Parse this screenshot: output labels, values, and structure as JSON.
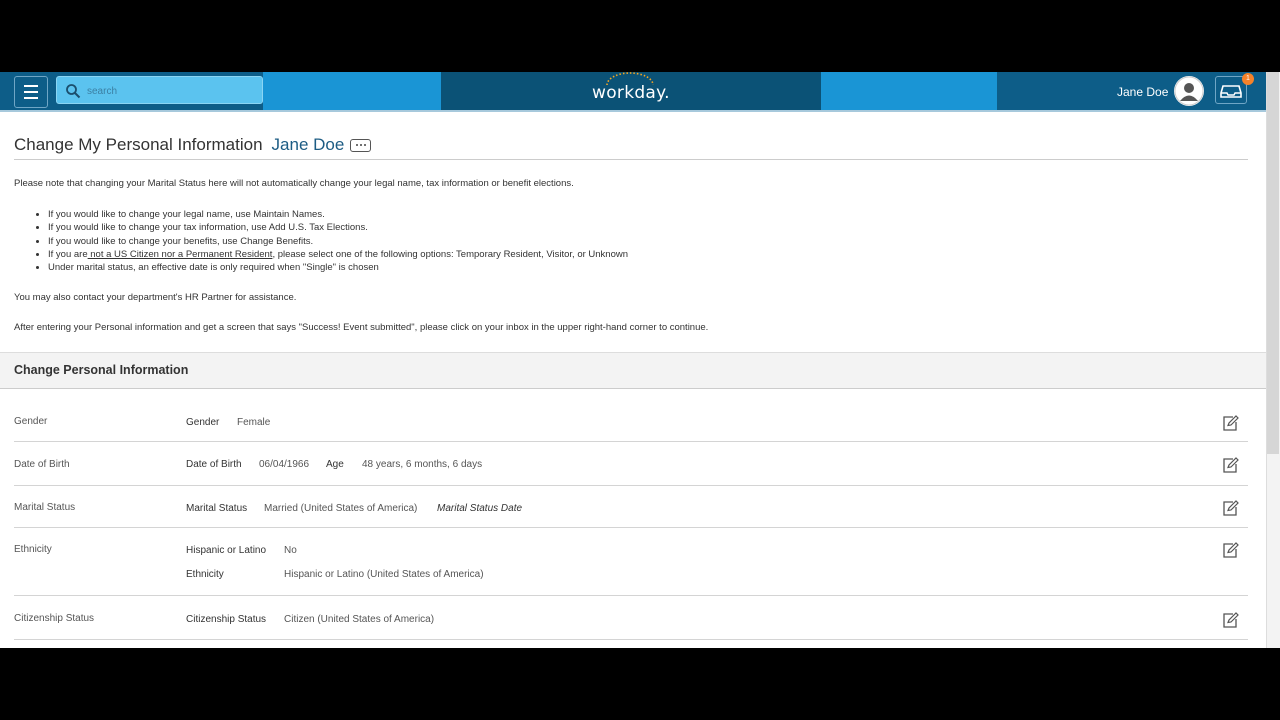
{
  "header": {
    "search_placeholder": "search",
    "logo": "workday.",
    "user_name": "Jane Doe",
    "inbox_count": "1",
    "colors": {
      "bar": "#0d5d88",
      "accent": "#1a95d5",
      "badge": "#f5822a"
    }
  },
  "page": {
    "title": "Change My Personal Information",
    "title_name": "Jane Doe",
    "intro": "Please note that changing your Marital Status here will not automatically change your legal name, tax information or benefit elections.",
    "bullets": {
      "b1": "If you would like to change your legal name, use Maintain Names.",
      "b2": "If you would like to change your tax information, use Add U.S. Tax Elections.",
      "b3": "If you would like to change your benefits, use Change Benefits.",
      "b4_pre": "If you are",
      "b4_link": " not a US Citizen nor a Permanent Resident",
      "b4_post": ", please select one of the following options: Temporary Resident, Visitor, or Unknown",
      "b5": "Under marital status, an effective date is only required when \"Single\" is chosen"
    },
    "contact": "You may also contact your department's HR Partner for assistance.",
    "after": "After entering your Personal information and get a screen that says \"Success! Event submitted\", please click on your inbox in the upper right-hand corner to continue."
  },
  "section": {
    "title": "Change Personal Information",
    "rows": {
      "gender": {
        "label": "Gender",
        "f1": "Gender",
        "v1": "Female"
      },
      "dob": {
        "label": "Date of Birth",
        "f1": "Date of Birth",
        "v1": "06/04/1966",
        "f2": "Age",
        "v2": "48 years, 6 months, 6 days"
      },
      "marital": {
        "label": "Marital Status",
        "f1": "Marital Status",
        "v1": "Married (United States of America)",
        "f2": "Marital Status Date"
      },
      "ethnicity": {
        "label": "Ethnicity",
        "f1": "Hispanic or Latino",
        "v1": "No",
        "f2": "Ethnicity",
        "v2": "Hispanic or Latino (United States of America)"
      },
      "citizenship": {
        "label": "Citizenship Status",
        "f1": "Citizenship Status",
        "v1": "Citizen (United States of America)"
      }
    }
  }
}
